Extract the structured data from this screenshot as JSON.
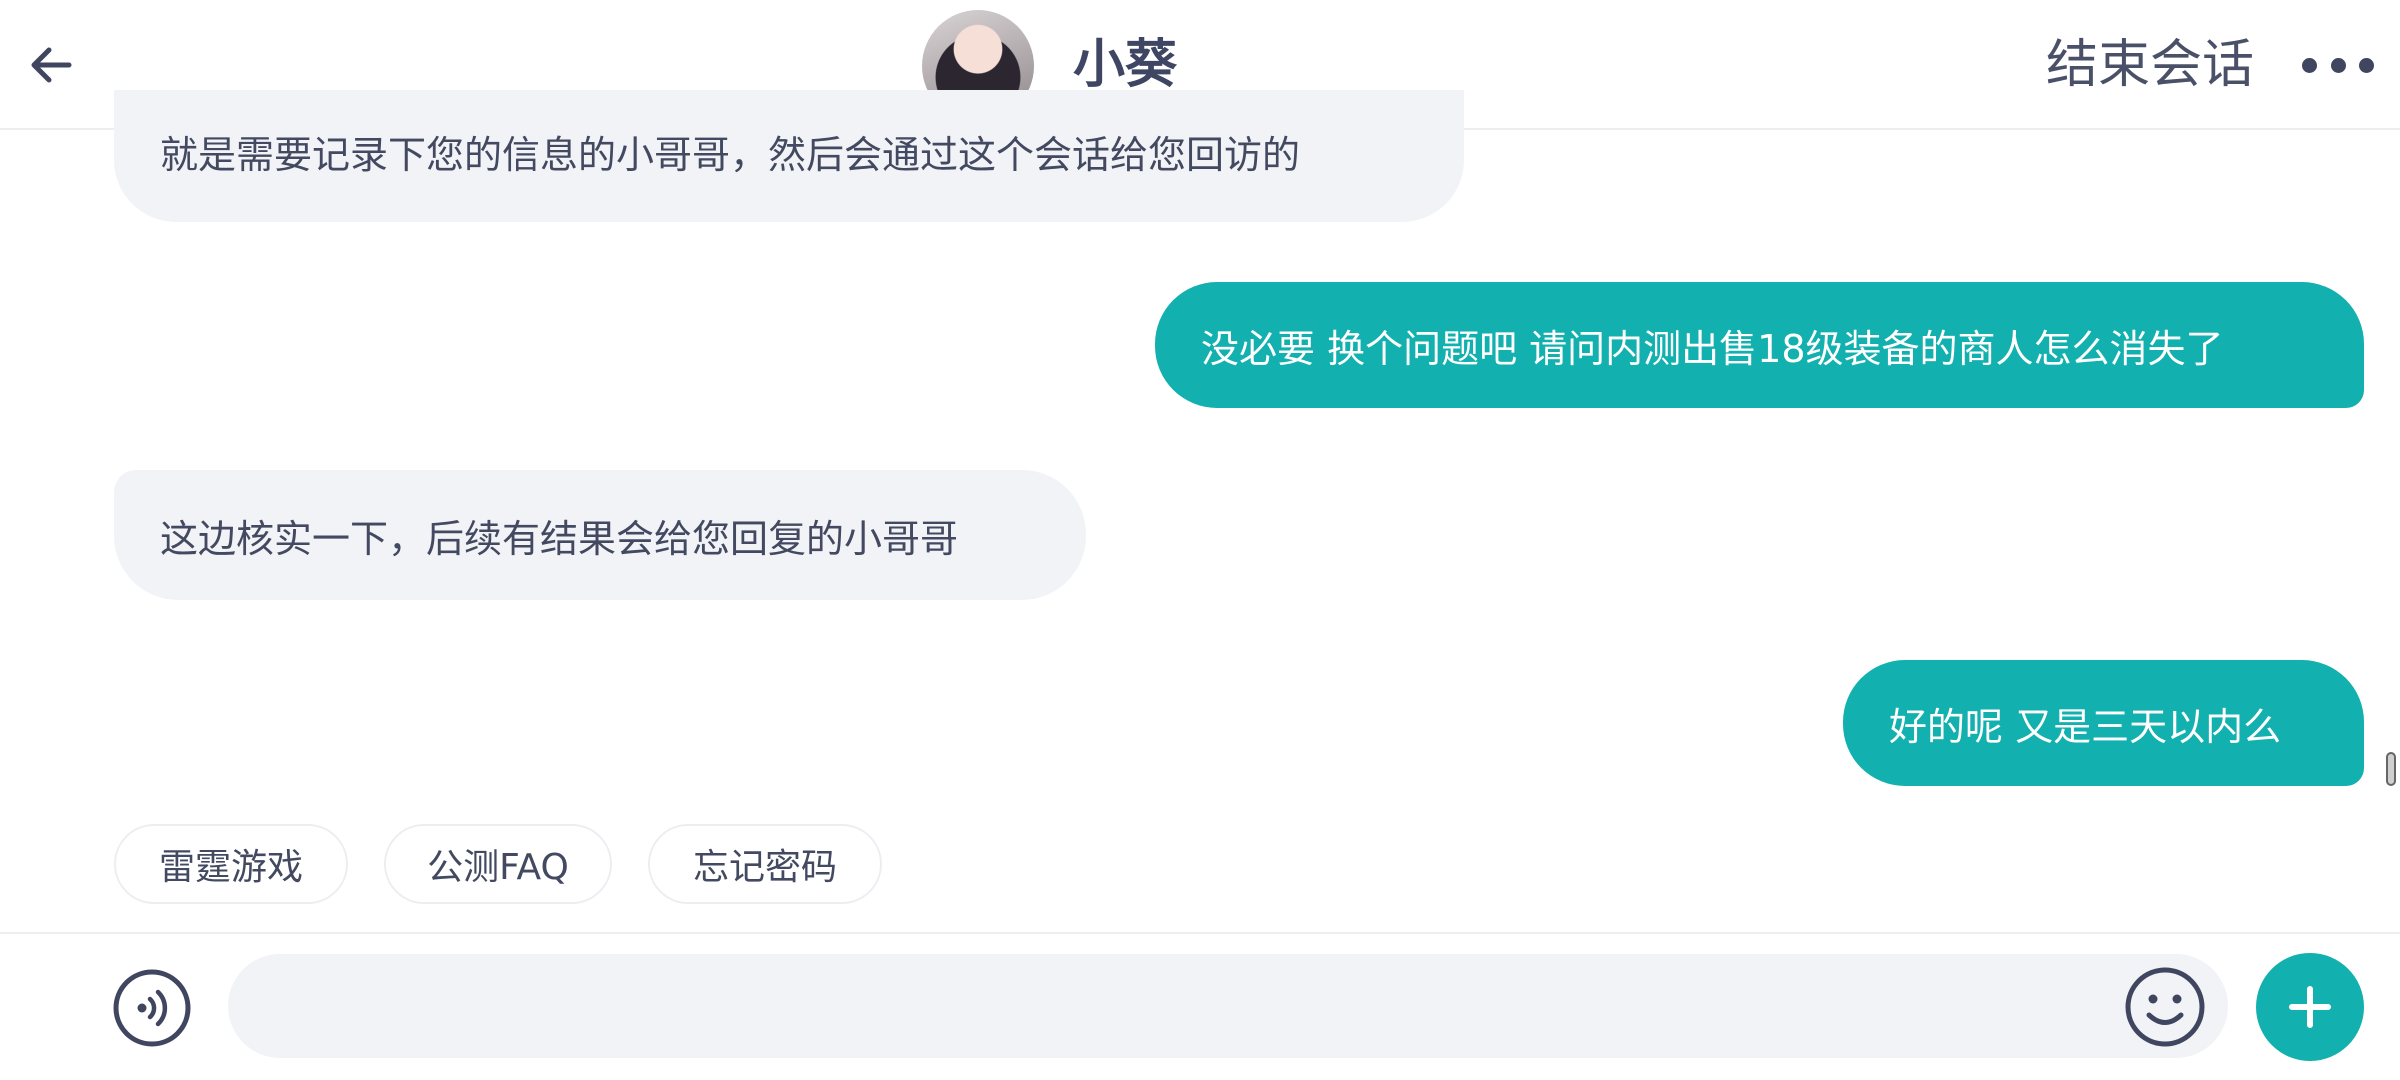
{
  "header": {
    "title": "小葵",
    "end_session_label": "结束会话",
    "back_icon": "arrow-left-icon",
    "more_icon": "more-horizontal-icon"
  },
  "messages": [
    {
      "sender": "agent",
      "text": "就是需要记录下您的信息的小哥哥，然后会通过这个会话给您回访的"
    },
    {
      "sender": "user",
      "text": "没必要 换个问题吧 请问内测出售18级装备的商人怎么消失了"
    },
    {
      "sender": "agent",
      "text": "这边核实一下，后续有结果会给您回复的小哥哥"
    },
    {
      "sender": "user",
      "text": "好的呢 又是三天以内么"
    }
  ],
  "quick_replies": [
    "雷霆游戏",
    "公测FAQ",
    "忘记密码"
  ],
  "input": {
    "value": "",
    "placeholder": "",
    "voice_icon": "voice-icon",
    "emoji_icon": "emoji-icon",
    "plus_icon": "plus-icon"
  },
  "colors": {
    "accent": "#12b0ae",
    "agent_bubble": "#f1f3f6",
    "text": "#424961"
  }
}
